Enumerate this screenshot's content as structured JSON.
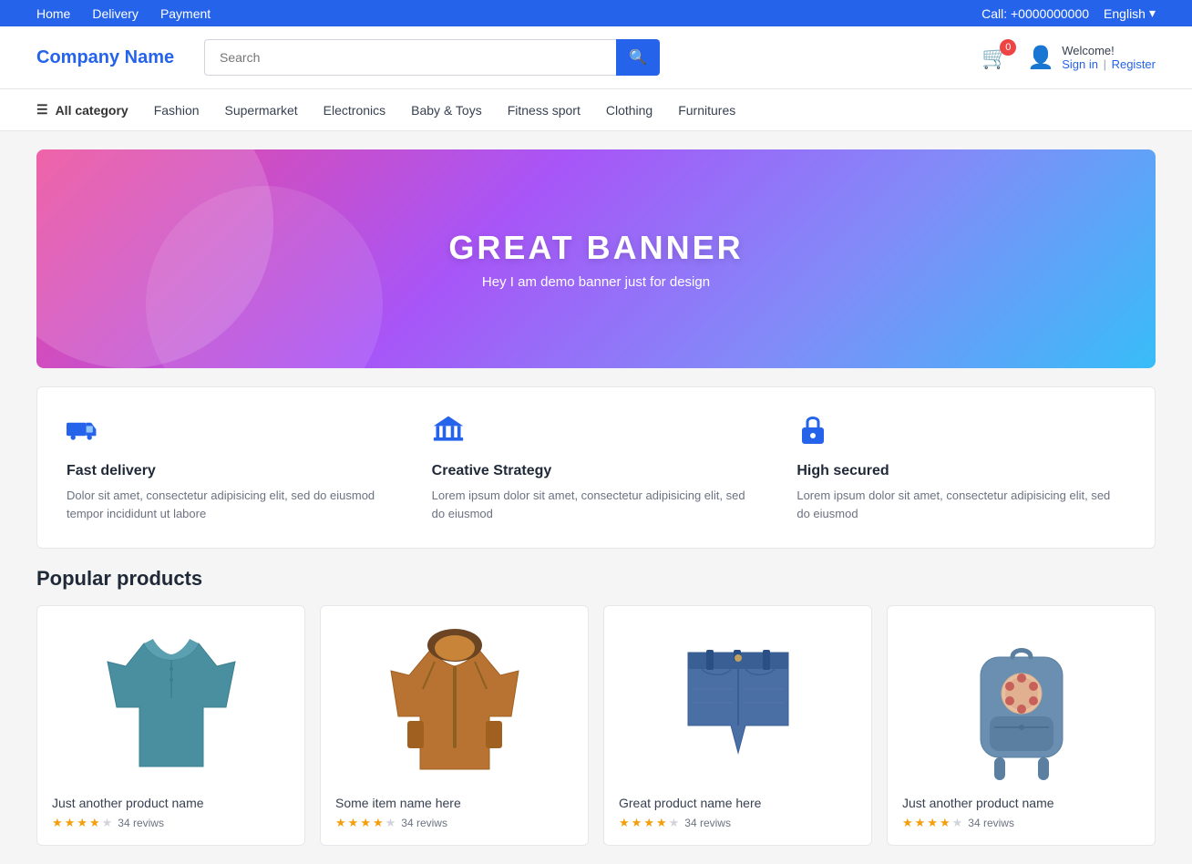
{
  "topbar": {
    "nav_links": [
      "Home",
      "Delivery",
      "Payment"
    ],
    "phone_label": "Call: +0000000000",
    "language": "English"
  },
  "header": {
    "logo": "Company Name",
    "search_placeholder": "Search",
    "cart_count": "0",
    "welcome_text": "Welcome!",
    "sign_in_label": "Sign in",
    "separator": "|",
    "register_label": "Register"
  },
  "nav": {
    "all_category": "All category",
    "items": [
      "Fashion",
      "Supermarket",
      "Electronics",
      "Baby &amp; Toys",
      "Fitness sport",
      "Clothing",
      "Furnitures"
    ]
  },
  "banner": {
    "title": "GREAT BANNER",
    "subtitle": "Hey I am demo banner just for design"
  },
  "features": [
    {
      "icon": "truck",
      "title": "Fast delivery",
      "desc": "Dolor sit amet, consectetur adipisicing elit, sed do eiusmod tempor incididunt ut labore"
    },
    {
      "icon": "bank",
      "title": "Creative Strategy",
      "desc": "Lorem ipsum dolor sit amet, consectetur adipisicing elit, sed do eiusmod"
    },
    {
      "icon": "lock",
      "title": "High secured",
      "desc": "Lorem ipsum dolor sit amet, consectetur adipisicing elit, sed do eiusmod"
    }
  ],
  "popular_section": {
    "title": "Popular products"
  },
  "products": [
    {
      "name": "Just another product name",
      "rating": 4,
      "reviews": "34 reviws",
      "type": "shirt"
    },
    {
      "name": "Some item name here",
      "rating": 4,
      "reviews": "34 reviws",
      "type": "jacket"
    },
    {
      "name": "Great product name here",
      "rating": 4,
      "reviews": "34 reviws",
      "type": "shorts"
    },
    {
      "name": "Just another product name",
      "rating": 4,
      "reviews": "34 reviws",
      "type": "backpack"
    }
  ]
}
